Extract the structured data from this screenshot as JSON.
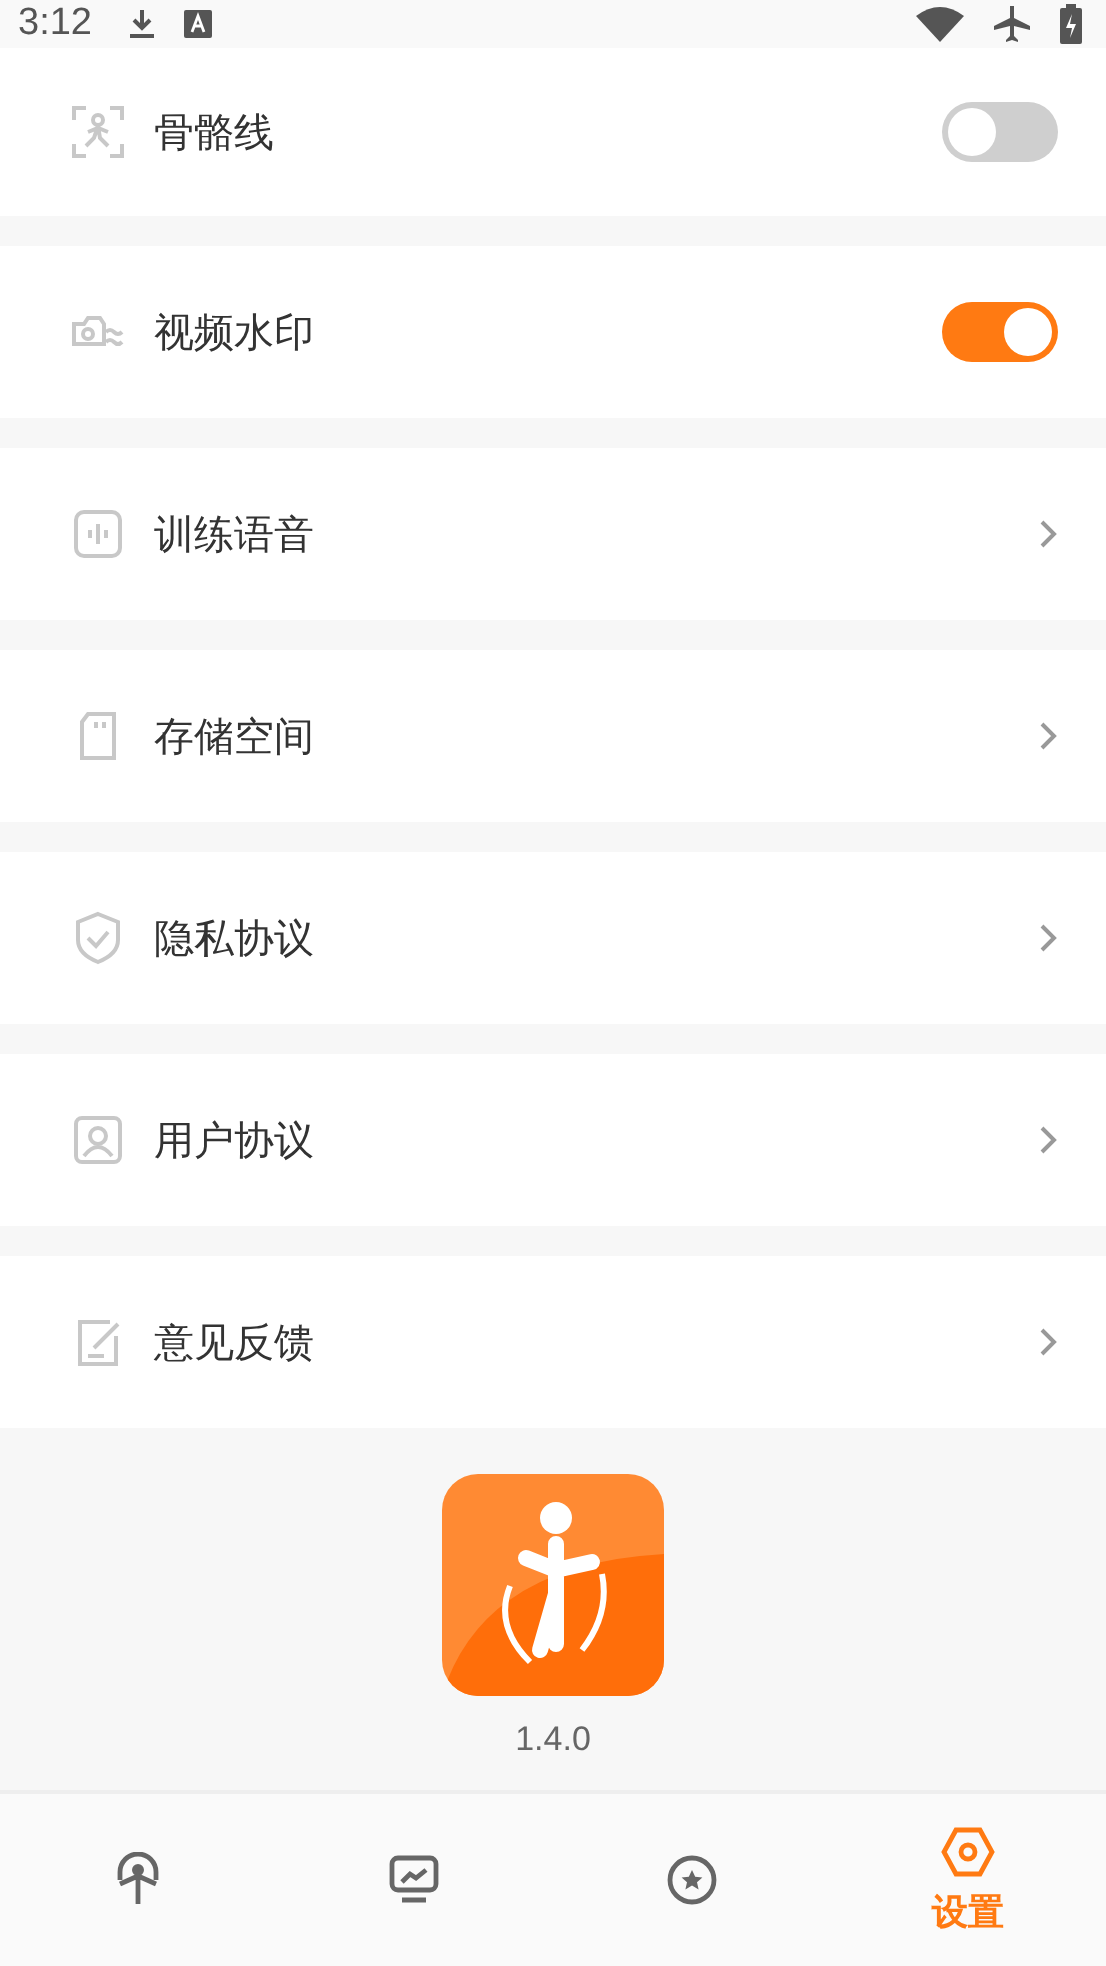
{
  "status_bar": {
    "time": "3:12"
  },
  "settings": [
    {
      "kind": "toggle",
      "label": "骨骼线",
      "on": false
    },
    {
      "kind": "toggle",
      "label": "视频水印",
      "on": true
    },
    {
      "kind": "link",
      "label": "训练语音"
    },
    {
      "kind": "link",
      "label": "存储空间"
    },
    {
      "kind": "link",
      "label": "隐私协议"
    },
    {
      "kind": "link",
      "label": "用户协议"
    },
    {
      "kind": "link",
      "label": "意见反馈"
    }
  ],
  "app": {
    "version": "1.4.0"
  },
  "bottom_nav": [
    {
      "selected": false
    },
    {
      "selected": false
    },
    {
      "selected": false
    },
    {
      "label": "设置",
      "selected": true
    }
  ]
}
